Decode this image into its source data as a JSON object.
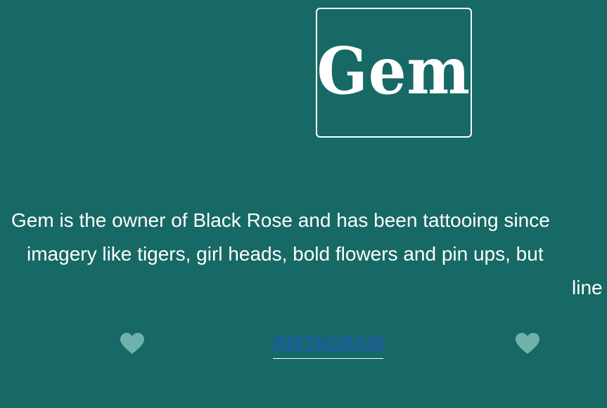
{
  "logo": {
    "text": "Gem"
  },
  "bio": {
    "line1": "Gem is the owner of Black Rose and has been tattooing since",
    "line2": "imagery like tigers, girl heads, bold flowers and pin ups, but",
    "line3": "line"
  },
  "links": {
    "instagram_label": "INSTAGRAM"
  },
  "colors": {
    "background": "#166964",
    "heart": "#6fb2ab",
    "link": "#1c5aa8",
    "text": "#ffffff"
  },
  "icons": {
    "left": "heart-icon",
    "right": "heart-icon"
  }
}
